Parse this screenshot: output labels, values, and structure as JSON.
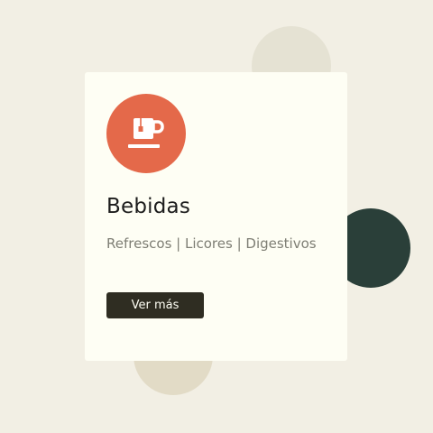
{
  "card": {
    "icon": "tea-cup-icon",
    "title": "Bebidas",
    "subtitle": "Refrescos | Licores | Digestivos",
    "button_label": "Ver más"
  },
  "colors": {
    "background": "#f2efe4",
    "card": "#fefef4",
    "icon_circle": "#e4694a",
    "button": "#2f2d22",
    "dark_blob": "#2a3f39",
    "light_blob": "#e5e2d3"
  }
}
